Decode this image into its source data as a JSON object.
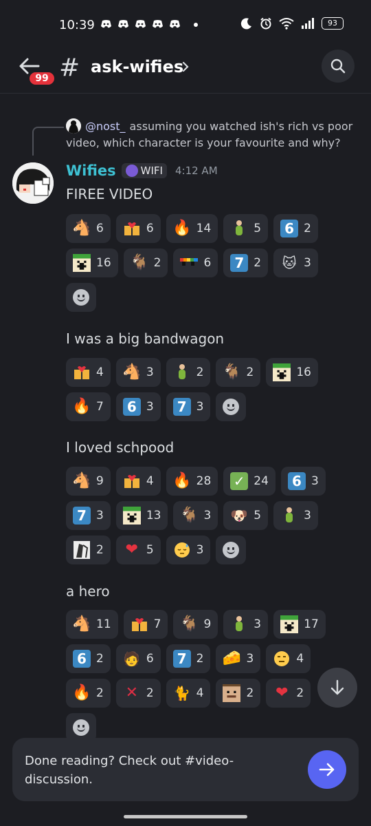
{
  "status_bar": {
    "time": "10:39",
    "battery": "93"
  },
  "header": {
    "back_badge": "99",
    "channel": "ask-wifies"
  },
  "reply": {
    "username": "@nost_",
    "text": "assuming you watched ish's rich vs poor video, which character is your favourite and why?"
  },
  "message": {
    "author": "Wifies",
    "tag": "WIFI",
    "timestamp": "4:12 AM",
    "lines": [
      "FIREE VIDEO",
      "I was a big bandwagon",
      "I loved schpood",
      "a hero"
    ]
  },
  "reaction_groups": [
    [
      {
        "icon": "horse-icon",
        "count": "6"
      },
      {
        "icon": "heart-hands-icon",
        "count": "6"
      },
      {
        "icon": "fire-icon",
        "count": "14"
      },
      {
        "icon": "green-figure-icon",
        "count": "5"
      },
      {
        "icon": "keycap-6-icon",
        "count": "2"
      },
      {
        "icon": "pixel-face-icon",
        "count": "16"
      },
      {
        "icon": "goat-icon",
        "count": "2"
      },
      {
        "icon": "rainbow-sunglasses-icon",
        "count": "6"
      },
      {
        "icon": "keycap-7-icon",
        "count": "2"
      },
      {
        "icon": "cat-cartoon-icon",
        "count": "3"
      }
    ],
    [
      {
        "icon": "heart-hands-icon",
        "count": "4"
      },
      {
        "icon": "horse-icon",
        "count": "3"
      },
      {
        "icon": "green-figure-icon",
        "count": "2"
      },
      {
        "icon": "goat-icon",
        "count": "2"
      },
      {
        "icon": "pixel-face-icon",
        "count": "16"
      },
      {
        "icon": "fire-icon",
        "count": "7"
      },
      {
        "icon": "keycap-6-icon",
        "count": "3"
      },
      {
        "icon": "keycap-7-icon",
        "count": "3"
      }
    ],
    [
      {
        "icon": "horse-icon",
        "count": "9"
      },
      {
        "icon": "heart-hands-icon",
        "count": "4"
      },
      {
        "icon": "fire-icon",
        "count": "28"
      },
      {
        "icon": "check-mark-icon",
        "count": "24"
      },
      {
        "icon": "keycap-6-icon",
        "count": "3"
      },
      {
        "icon": "keycap-7-icon",
        "count": "3"
      },
      {
        "icon": "pixel-face-icon",
        "count": "13"
      },
      {
        "icon": "goat-icon",
        "count": "3"
      },
      {
        "icon": "screaming-dog-icon",
        "count": "5"
      },
      {
        "icon": "green-figure-icon",
        "count": "3"
      },
      {
        "icon": "sketch-figure-icon",
        "count": "2"
      },
      {
        "icon": "red-heart-icon",
        "count": "5"
      },
      {
        "icon": "sleepy-face-icon",
        "count": "3"
      }
    ],
    [
      {
        "icon": "horse-icon",
        "count": "11"
      },
      {
        "icon": "heart-hands-icon",
        "count": "7"
      },
      {
        "icon": "goat-icon",
        "count": "9"
      },
      {
        "icon": "green-figure-icon",
        "count": "3"
      },
      {
        "icon": "pixel-face-icon",
        "count": "17"
      },
      {
        "icon": "keycap-6-icon",
        "count": "2"
      },
      {
        "icon": "anime-character-icon",
        "count": "6"
      },
      {
        "icon": "keycap-7-icon",
        "count": "2"
      },
      {
        "icon": "cheese-icon",
        "count": "3"
      },
      {
        "icon": "expressionless-face-icon",
        "count": "4"
      },
      {
        "icon": "fire-icon",
        "count": "2"
      },
      {
        "icon": "cross-mark-icon",
        "count": "2"
      },
      {
        "icon": "cat-meme-icon",
        "count": "4"
      },
      {
        "icon": "pixel-man-icon",
        "count": "2"
      },
      {
        "icon": "red-heart-icon",
        "count": "2"
      }
    ]
  ],
  "banner": {
    "text": "Done reading? Check out #video-discussion."
  }
}
